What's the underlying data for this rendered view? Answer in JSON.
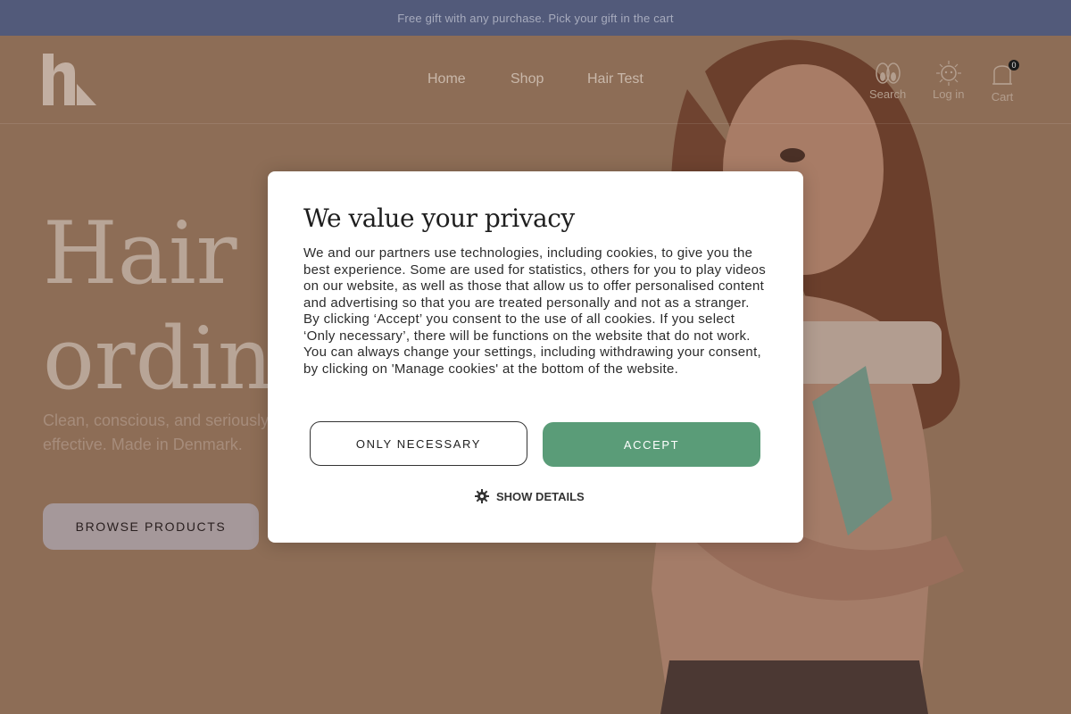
{
  "announcement": "Free gift with any purchase. Pick your gift in the cart",
  "nav": {
    "home": "Home",
    "shop": "Shop",
    "hair_test": "Hair Test"
  },
  "header_icons": {
    "search": "Search",
    "login": "Log in",
    "cart": "Cart",
    "cart_count": "0"
  },
  "hero": {
    "title_line1": "Hair care",
    "title_line2": "ordinary",
    "subtitle": "Clean, conscious, and seriously effective. Made in Denmark.",
    "browse_button": "BROWSE PRODUCTS"
  },
  "modal": {
    "title": "We value your privacy",
    "body": "We and our partners use technologies, including cookies, to give you the best experience. Some are used for statistics, others for you to play videos on our website, as well as those that allow us to offer personalised content and advertising so that you are treated personally and not as a stranger. By clicking ‘Accept’ you consent to the use of all cookies. If you select ‘Only necessary’, there will be functions on the website that do not work. You can always change your settings, including withdrawing your consent, by clicking on 'Manage cookies' at the bottom of the website.",
    "only_necessary": "ONLY NECESSARY",
    "accept": "ACCEPT",
    "show_details": "SHOW DETAILS"
  },
  "colors": {
    "accept_green": "#5a9c78",
    "announcement_bg": "#525a7a",
    "overlay_tint": "#8d6d56"
  }
}
